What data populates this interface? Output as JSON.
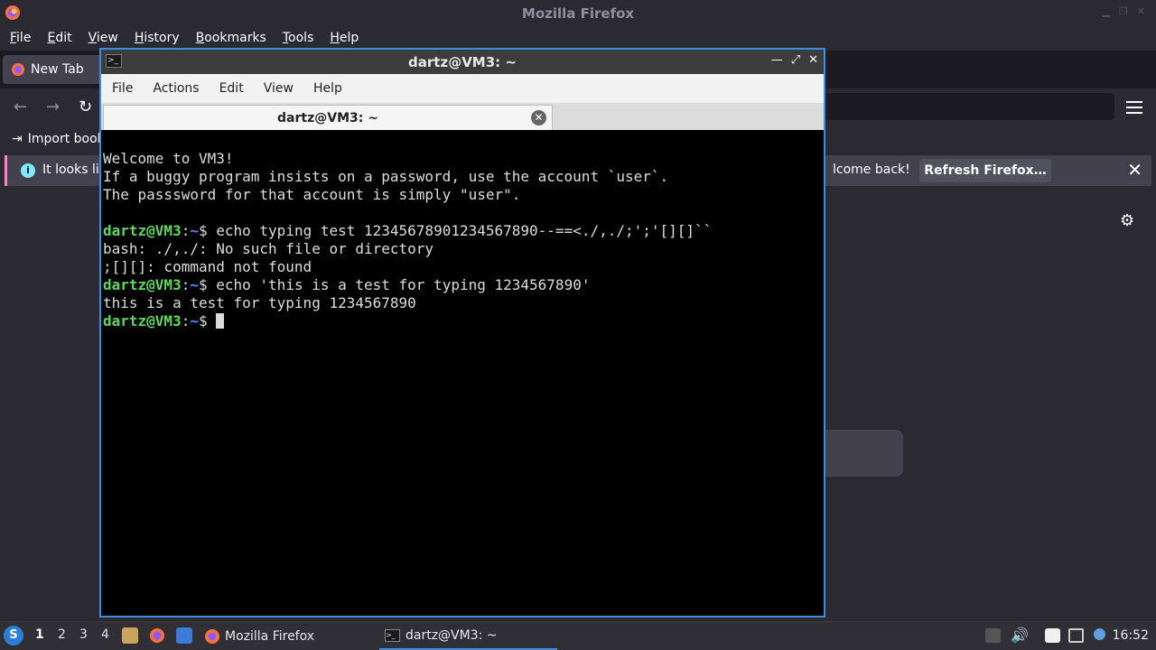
{
  "firefox": {
    "window_title": "Mozilla Firefox",
    "menu": [
      "File",
      "Edit",
      "View",
      "History",
      "Bookmarks",
      "Tools",
      "Help"
    ],
    "tab_label": "New Tab",
    "bookmarks_label": "Import book",
    "notice_left": "It looks lik",
    "notice_right": "lcome back!",
    "refresh_button": "Refresh Firefox…",
    "notice_color": "#ff84c6"
  },
  "terminal": {
    "window_title": "dartz@VM3: ~",
    "menu": [
      "File",
      "Actions",
      "Edit",
      "View",
      "Help"
    ],
    "tab_label": "dartz@VM3: ~",
    "prompt_user": "dartz@VM3",
    "prompt_sep": ":",
    "prompt_path": "~",
    "prompt_suffix": "$ ",
    "lines": [
      "Welcome to VM3!",
      "If a buggy program insists on a password, use the account `user`.",
      "The passsword for that account is simply \"user\".",
      "",
      "echo typing test 12345678901234567890--==<./,./;';'[][]``",
      "bash: ./,./: No such file or directory",
      ";[][]: command not found",
      "echo 'this is a test for typing 1234567890'",
      "this is a test for typing 1234567890"
    ]
  },
  "taskbar": {
    "workspaces": [
      "1",
      "2",
      "3",
      "4"
    ],
    "task_firefox": "Mozilla Firefox",
    "task_terminal": "dartz@VM3: ~",
    "clock": "16:52"
  }
}
